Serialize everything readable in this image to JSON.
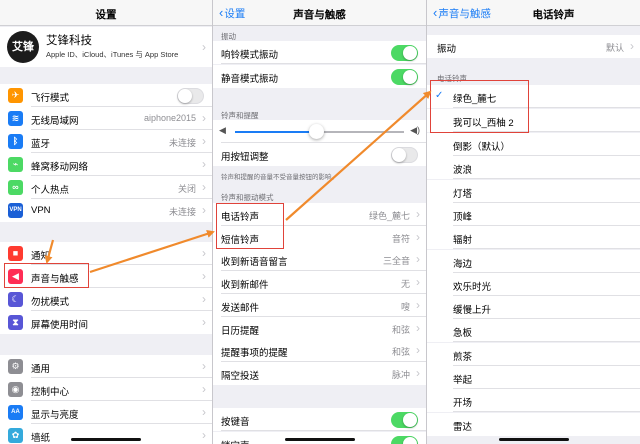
{
  "panel1": {
    "title": "设置",
    "profile": {
      "avatar_text": "艾锋",
      "name": "艾锋科技",
      "subtitle": "Apple ID、iCloud、iTunes 与 App Store"
    },
    "group1": [
      {
        "label": "飞行模式",
        "icon": "airplane-icon",
        "color": "#ff9500",
        "glyph": "✈",
        "toggle": "off"
      },
      {
        "label": "无线局域网",
        "icon": "wifi-icon",
        "color": "#1a7cf5",
        "glyph": "≋",
        "value": "aiphone2015"
      },
      {
        "label": "蓝牙",
        "icon": "bluetooth-icon",
        "color": "#1a7cf5",
        "glyph": "ᛒ",
        "value": "未连接"
      },
      {
        "label": "蜂窝移动网络",
        "icon": "cellular-icon",
        "color": "#4cd964",
        "glyph": "⌁"
      },
      {
        "label": "个人热点",
        "icon": "hotspot-icon",
        "color": "#4cd964",
        "glyph": "∞",
        "value": "关闭"
      },
      {
        "label": "VPN",
        "icon": "vpn-icon",
        "color": "#1a5fd6",
        "glyph": "VPN",
        "value": "未连接"
      }
    ],
    "group2": [
      {
        "label": "通知",
        "icon": "notification-icon",
        "color": "#ff3b30",
        "glyph": "■"
      },
      {
        "label": "声音与触感",
        "icon": "sound-icon",
        "color": "#ff2d55",
        "glyph": "◀"
      },
      {
        "label": "勿扰模式",
        "icon": "moon-icon",
        "color": "#5856d6",
        "glyph": "☾"
      },
      {
        "label": "屏幕使用时间",
        "icon": "hourglass-icon",
        "color": "#5856d6",
        "glyph": "⧗"
      }
    ],
    "group3": [
      {
        "label": "通用",
        "icon": "gear-icon",
        "color": "#8e8e93",
        "glyph": "⚙"
      },
      {
        "label": "控制中心",
        "icon": "control-center-icon",
        "color": "#8e8e93",
        "glyph": "◉"
      },
      {
        "label": "显示与亮度",
        "icon": "display-icon",
        "color": "#1a7cf5",
        "glyph": "AA"
      },
      {
        "label": "墙纸",
        "icon": "wallpaper-icon",
        "color": "#34aadc",
        "glyph": "✿"
      }
    ]
  },
  "panel2": {
    "back": "设置",
    "title": "声音与触感",
    "vibrate_header": "振动",
    "vibrate_rows": [
      {
        "label": "响铃模式振动",
        "toggle": "on"
      },
      {
        "label": "静音模式振动",
        "toggle": "on"
      }
    ],
    "ringer_header": "铃声和提醒",
    "volume_level": 0.48,
    "change_with_buttons": {
      "label": "用按钮调整",
      "toggle": "off"
    },
    "ringer_footnote": "铃声和提醒的音量不受音量按钮的影响。",
    "patterns_header": "铃声和振动模式",
    "patterns": [
      {
        "label": "电话铃声",
        "value": "绿色_麓七"
      },
      {
        "label": "短信铃声",
        "value": "音符"
      },
      {
        "label": "收到新语音留言",
        "value": "三全音"
      },
      {
        "label": "收到新邮件",
        "value": "无"
      },
      {
        "label": "发送邮件",
        "value": "嗖"
      },
      {
        "label": "日历提醒",
        "value": "和弦"
      },
      {
        "label": "提醒事项的提醒",
        "value": "和弦"
      },
      {
        "label": "隔空投送",
        "value": "脉冲"
      }
    ],
    "bottom_rows": [
      {
        "label": "按键音",
        "toggle": "on"
      },
      {
        "label": "锁定声",
        "toggle": "on"
      }
    ]
  },
  "panel3": {
    "back": "声音与触感",
    "title": "电话铃声",
    "vibration": {
      "label": "振动",
      "value": "默认"
    },
    "ringtones_header": "电话铃声",
    "custom": [
      {
        "label": "绿色_麓七",
        "selected": true
      },
      {
        "label": "我可以_西柚 2",
        "selected": false
      }
    ],
    "builtin": [
      "倒影（默认）",
      "波浪",
      "灯塔",
      "顶峰",
      "辐射",
      "海边",
      "欢乐时光",
      "缓慢上升",
      "急板",
      "煎茶",
      "举起",
      "开场",
      "雷达"
    ]
  },
  "colors": {
    "accent": "#1a7cf5",
    "toggle_on": "#4cd964",
    "highlight": "#e0433a",
    "arrow": "#f08a2c"
  }
}
